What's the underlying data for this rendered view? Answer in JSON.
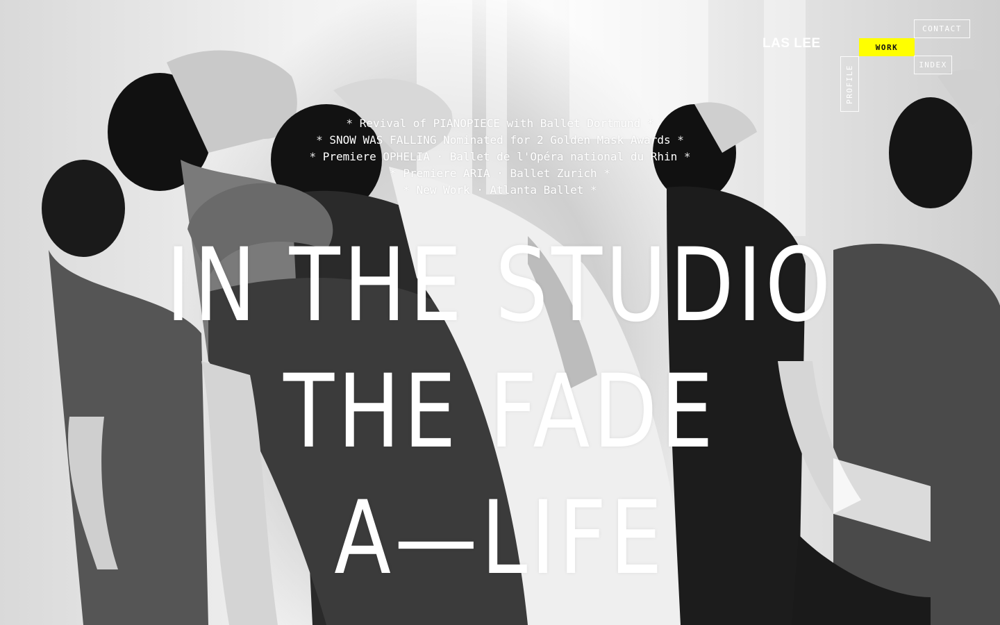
{
  "brand": {
    "name": "LAS LEE"
  },
  "nav": {
    "contact": "CONTACT",
    "work": "WORK",
    "index": "INDEX",
    "profile": "PROFILE",
    "active": "WORK",
    "accent_color": "#ffff00"
  },
  "news": [
    {
      "text": "Revival of PIANOPIECE with Ballet Dortmund",
      "lead": "*",
      "trail": "*"
    },
    {
      "text": "SNOW WAS FALLING Nominated for 2 Golden Mask Awards",
      "lead": "*",
      "trail": "*"
    },
    {
      "text": "Premiere OPHELIA · Ballet de l'Opéra national du Rhin",
      "lead": "*",
      "trail": "*"
    },
    {
      "text": "Premiere ARIA · Ballet Zurich",
      "lead": "*",
      "trail": "*"
    },
    {
      "text": "New Work · Atlanta Ballet",
      "lead": "*",
      "trail": "*"
    }
  ],
  "works": [
    {
      "title": "IN THE STUDIO"
    },
    {
      "title": "THE FADE"
    },
    {
      "title": "A—LIFE"
    }
  ],
  "background": {
    "description_icon": "dancers-photo",
    "tone": "grayscale"
  }
}
